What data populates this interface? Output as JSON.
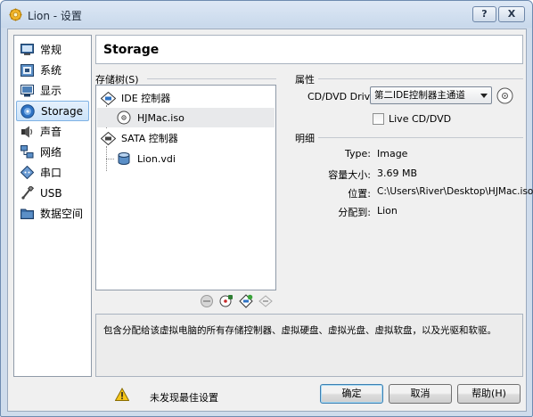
{
  "window": {
    "title": "Lion - 设置",
    "help_button": "?",
    "close_button": "X"
  },
  "sidebar": {
    "items": [
      {
        "label": "常规",
        "icon": "general-icon",
        "selected": false
      },
      {
        "label": "系统",
        "icon": "system-icon",
        "selected": false
      },
      {
        "label": "显示",
        "icon": "display-icon",
        "selected": false
      },
      {
        "label": "Storage",
        "icon": "storage-icon",
        "selected": true
      },
      {
        "label": "声音",
        "icon": "audio-icon",
        "selected": false
      },
      {
        "label": "网络",
        "icon": "network-icon",
        "selected": false
      },
      {
        "label": "串口",
        "icon": "serial-port-icon",
        "selected": false
      },
      {
        "label": "USB",
        "icon": "usb-icon",
        "selected": false
      },
      {
        "label": "数据空间",
        "icon": "shared-folders-icon",
        "selected": false
      }
    ]
  },
  "page": {
    "title": "Storage"
  },
  "storage_tree": {
    "group_label": "存储树(S)",
    "controllers": [
      {
        "label": "IDE 控制器",
        "icon": "ide-controller-icon",
        "attachments": [
          {
            "label": "HJMac.iso",
            "icon": "optical-disc-icon",
            "selected": true
          }
        ]
      },
      {
        "label": "SATA 控制器",
        "icon": "sata-controller-icon",
        "attachments": [
          {
            "label": "Lion.vdi",
            "icon": "hard-disk-icon",
            "selected": false
          }
        ]
      }
    ],
    "tools": [
      "remove-controller-icon",
      "add-cd-icon",
      "add-hard-disk-icon",
      "remove-attachment-icon"
    ]
  },
  "attributes": {
    "group_label": "属性",
    "drive_label": "CD/DVD Drive:",
    "drive_value": "第二IDE控制器主通道",
    "live_cd_label": "Live CD/DVD",
    "live_cd_checked": false
  },
  "details": {
    "group_label": "明细",
    "rows": [
      {
        "label": "Type:",
        "value": "Image"
      },
      {
        "label": "容量大小:",
        "value": "3.69 MB"
      },
      {
        "label": "位置:",
        "value": "C:\\Users\\River\\Desktop\\HJMac.iso"
      },
      {
        "label": "分配到:",
        "value": "Lion"
      }
    ]
  },
  "description": "包含分配给该虚拟电脑的所有存储控制器、虚拟硬盘、虚拟光盘、虚拟软盘，以及光驱和软驱。",
  "footer": {
    "warning": "未发现最佳设置",
    "ok": "确定",
    "cancel": "取消",
    "help": "帮助(H)"
  }
}
